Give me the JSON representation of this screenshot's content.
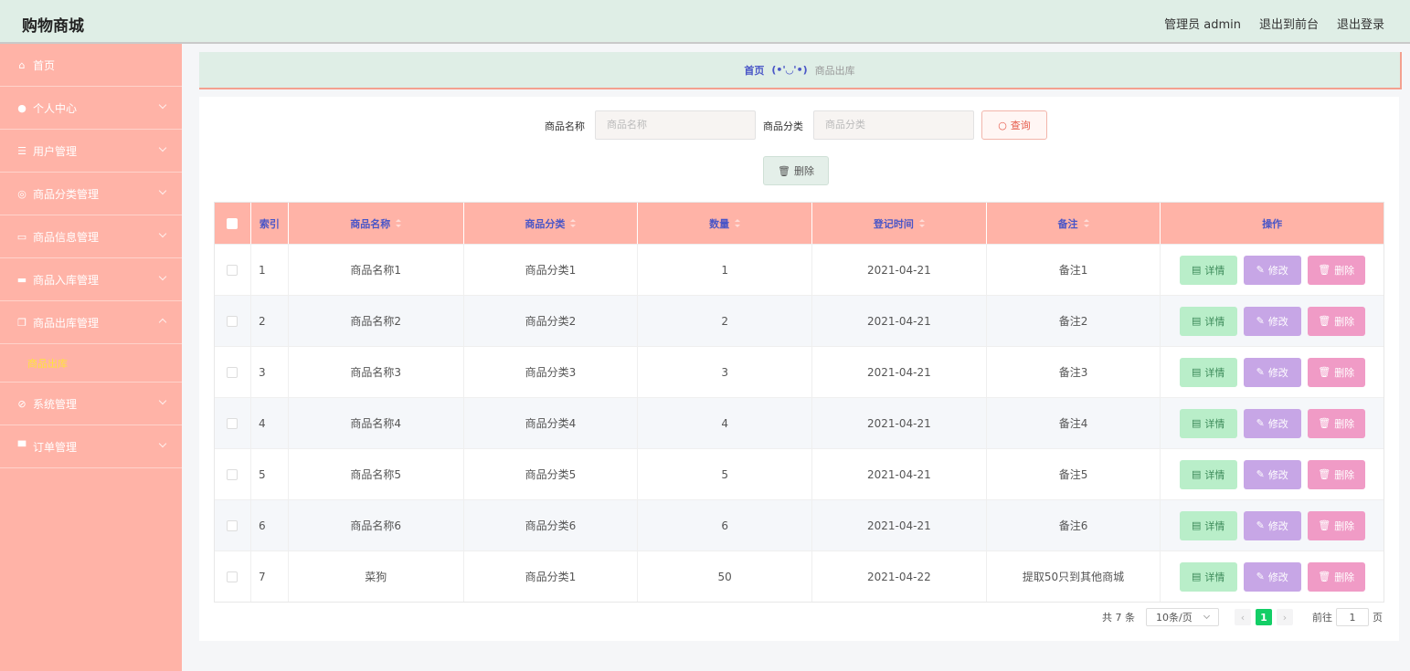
{
  "header": {
    "brand": "购物商城",
    "admin_label": "管理员 admin",
    "front_link": "退出到前台",
    "logout_link": "退出登录"
  },
  "sidebar": {
    "items": [
      {
        "label": "首页",
        "icon": "home-icon"
      },
      {
        "label": "个人中心",
        "icon": "user-icon"
      },
      {
        "label": "用户管理",
        "icon": "sliders-icon"
      },
      {
        "label": "商品分类管理",
        "icon": "compass-icon"
      },
      {
        "label": "商品信息管理",
        "icon": "message-icon"
      },
      {
        "label": "商品入库管理",
        "icon": "chat-icon"
      },
      {
        "label": "商品出库管理",
        "icon": "copy-icon"
      },
      {
        "label": "系统管理",
        "icon": "bell-off-icon"
      },
      {
        "label": "订单管理",
        "icon": "briefcase-icon"
      }
    ],
    "active_sub": "商品出库"
  },
  "breadcrumb": {
    "home": "首页",
    "separator": "(•'◡'•)",
    "current": "商品出库"
  },
  "search": {
    "name_label": "商品名称",
    "name_placeholder": "商品名称",
    "category_label": "商品分类",
    "category_placeholder": "商品分类",
    "query_button": "查询",
    "delete_button": "删除"
  },
  "table": {
    "headers": {
      "index": "索引",
      "name": "商品名称",
      "category": "商品分类",
      "quantity": "数量",
      "date": "登记时间",
      "remark": "备注",
      "ops": "操作"
    },
    "op_labels": {
      "detail": "详情",
      "edit": "修改",
      "delete": "删除"
    },
    "rows": [
      {
        "index": "1",
        "name": "商品名称1",
        "category": "商品分类1",
        "quantity": "1",
        "date": "2021-04-21",
        "remark": "备注1"
      },
      {
        "index": "2",
        "name": "商品名称2",
        "category": "商品分类2",
        "quantity": "2",
        "date": "2021-04-21",
        "remark": "备注2"
      },
      {
        "index": "3",
        "name": "商品名称3",
        "category": "商品分类3",
        "quantity": "3",
        "date": "2021-04-21",
        "remark": "备注3"
      },
      {
        "index": "4",
        "name": "商品名称4",
        "category": "商品分类4",
        "quantity": "4",
        "date": "2021-04-21",
        "remark": "备注4"
      },
      {
        "index": "5",
        "name": "商品名称5",
        "category": "商品分类5",
        "quantity": "5",
        "date": "2021-04-21",
        "remark": "备注5"
      },
      {
        "index": "6",
        "name": "商品名称6",
        "category": "商品分类6",
        "quantity": "6",
        "date": "2021-04-21",
        "remark": "备注6"
      },
      {
        "index": "7",
        "name": "菜狗",
        "category": "商品分类1",
        "quantity": "50",
        "date": "2021-04-22",
        "remark": "提取50只到其他商城"
      }
    ]
  },
  "pagination": {
    "total": "共 7 条",
    "page_size": "10条/页",
    "current_page": "1",
    "goto_label": "前往",
    "goto_value": "1",
    "page_suffix": "页"
  }
}
